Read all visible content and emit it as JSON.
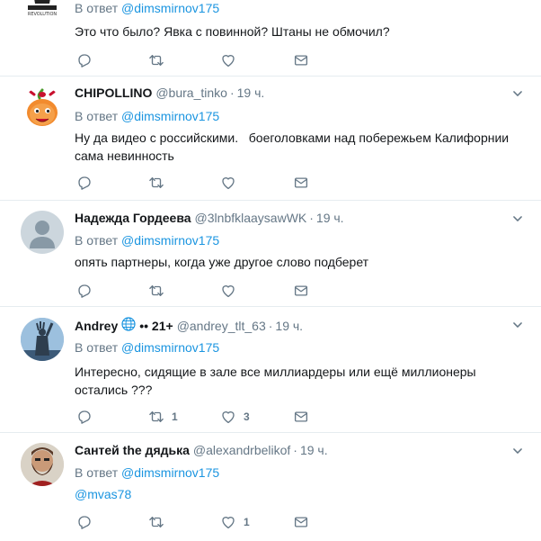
{
  "tweets": [
    {
      "name": "",
      "handle": "",
      "time": "",
      "reply_prefix": "В ответ",
      "reply_handle": "@dimsmirnov175",
      "text": "Это что было? Явка с повинной? Штаны не обмочил?",
      "avatar_text": "REVOLUTION",
      "replies": "",
      "retweets": "",
      "likes": ""
    },
    {
      "name": "CHIPOLLINO",
      "handle": "@bura_tinko",
      "time": "19 ч.",
      "reply_prefix": "В ответ",
      "reply_handle": "@dimsmirnov175",
      "text": "Ну да видео с российскими.   боеголовками над побережьем Калифорнии сама невинность",
      "replies": "",
      "retweets": "",
      "likes": ""
    },
    {
      "name": "Надежда Гордеева",
      "handle": "@3lnbfklaaysawWK",
      "time": "19 ч.",
      "reply_prefix": "В ответ",
      "reply_handle": "@dimsmirnov175",
      "text": "опять партнеры, когда уже другое слово подберет",
      "replies": "",
      "retweets": "",
      "likes": ""
    },
    {
      "name": "Andrey",
      "name_extra": "•• 21+",
      "handle": "@andrey_tlt_63",
      "time": "19 ч.",
      "reply_prefix": "В ответ",
      "reply_handle": "@dimsmirnov175",
      "text": "Интересно, сидящие в зале все миллиардеры или ещё миллионеры остались ???",
      "replies": "",
      "retweets": "1",
      "likes": "3"
    },
    {
      "name": "Сантей the дядька",
      "handle": "@alexandrbelikof",
      "time": "19 ч.",
      "reply_prefix": "В ответ",
      "reply_handle": "@dimsmirnov175",
      "text": "@mvas78",
      "replies": "",
      "retweets": "",
      "likes": "1"
    }
  ],
  "dot": "·",
  "icons": {
    "reply": "reply-icon",
    "retweet": "retweet-icon",
    "like": "heart-icon",
    "dm": "envelope-icon",
    "more": "chevron-down-icon",
    "globe": "globe-icon"
  },
  "colors": {
    "link": "#1b95e0",
    "muted": "#657786",
    "text": "#14171a",
    "divider": "#e6ecf0"
  }
}
